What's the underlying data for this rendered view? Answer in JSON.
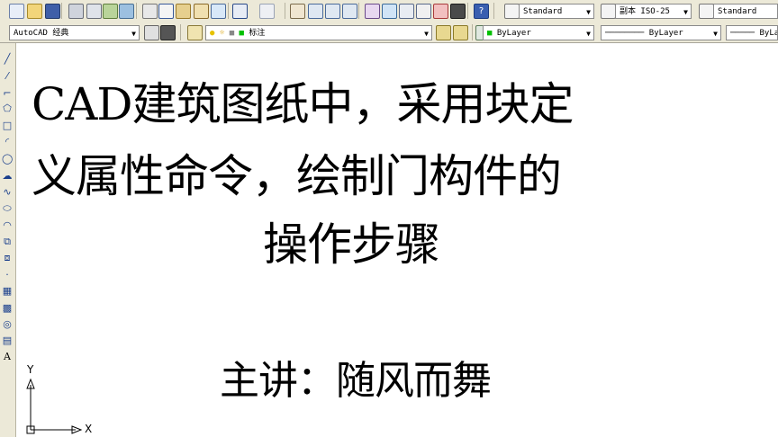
{
  "toolbar": {
    "text_style_value": "Standard",
    "dim_style_icon_label": "副本 ISO-25",
    "table_style_value": "Standard"
  },
  "workspace": {
    "value": "AutoCAD 经典"
  },
  "layer": {
    "current": "标注"
  },
  "properties": {
    "color": "ByLayer",
    "linetype": "ByLayer",
    "lineweight": "ByLa"
  },
  "left_toolbar": {
    "text_tool_glyph": "A"
  },
  "ucs": {
    "x_label": "X",
    "y_label": "Y"
  },
  "canvas_text": {
    "title_line1": "CAD建筑图纸中，采用块定",
    "title_line2": "义属性命令，绘制门构件的",
    "title_line3": "操作步骤",
    "presenter": "主讲：随风而舞"
  }
}
